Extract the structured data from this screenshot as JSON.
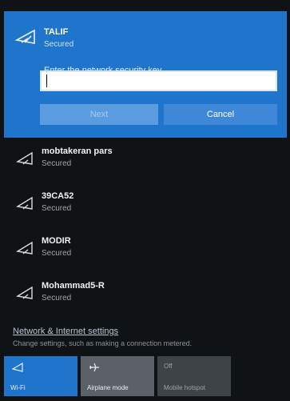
{
  "selected_network": {
    "name": "TALIF",
    "status": "Secured",
    "key_prompt": "Enter the network security key",
    "key_value": "",
    "next_label": "Next",
    "cancel_label": "Cancel",
    "icon": "wifi-icon"
  },
  "networks": [
    {
      "name": "mobtakeran pars",
      "status": "Secured",
      "icon": "wifi-secured-icon"
    },
    {
      "name": "39CA52",
      "status": "Secured",
      "icon": "wifi-secured-icon"
    },
    {
      "name": "MODIR",
      "status": "Secured",
      "icon": "wifi-secured-icon"
    },
    {
      "name": "Mohammad5-R",
      "status": "Secured",
      "icon": "wifi-secured-icon"
    }
  ],
  "settings": {
    "link": "Network & Internet settings",
    "description": "Change settings, such as making a connection metered."
  },
  "quick_actions": [
    {
      "label": "Wi-Fi",
      "icon": "wifi-icon",
      "state": "on"
    },
    {
      "label": "Airplane mode",
      "icon": "airplane-icon",
      "state": "off"
    },
    {
      "label": "Mobile hotspot",
      "top_text": "Off",
      "icon": "hotspot-icon",
      "state": "disabled"
    }
  ],
  "colors": {
    "accent": "#1f74cc",
    "background": "#101315"
  }
}
